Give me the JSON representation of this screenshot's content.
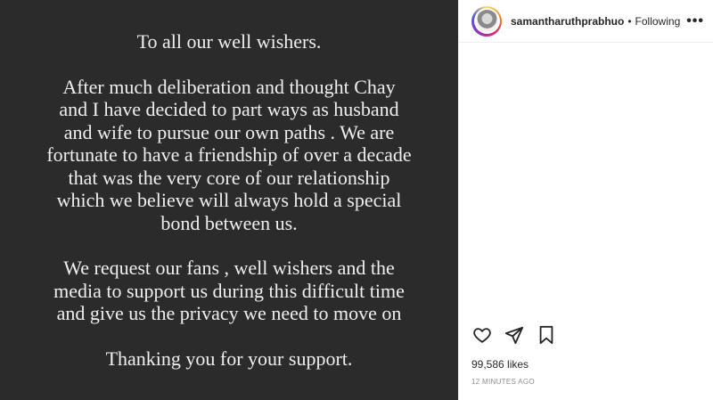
{
  "post": {
    "image_text": {
      "greeting": "To all our well wishers.",
      "para1": [
        "After much deliberation and thought Chay",
        "and I have decided to part ways as husband",
        "and wife to pursue our own paths . We are",
        "fortunate to have a friendship of over a decade",
        "that was the very core of our relationship",
        "which we believe will always hold a special",
        "bond between us."
      ],
      "para2": [
        "We request our fans , well wishers and the",
        "media to support us during this difficult time",
        "and give us the privacy we need to move on"
      ],
      "closing": "Thanking you for your support."
    }
  },
  "header": {
    "username": "samantharuthprabhuo",
    "separator": "•",
    "follow_status": "Following",
    "more_label": "•••"
  },
  "actions": {
    "icons": [
      "heart-icon",
      "share-icon",
      "bookmark-icon"
    ]
  },
  "stats": {
    "likes": "99,586 likes",
    "time_ago": "12 MINUTES AGO"
  },
  "colors": {
    "image_bg": "#2b2b2b",
    "image_text": "#efefef",
    "text_primary": "#262626",
    "text_secondary": "#8e8e8e"
  }
}
